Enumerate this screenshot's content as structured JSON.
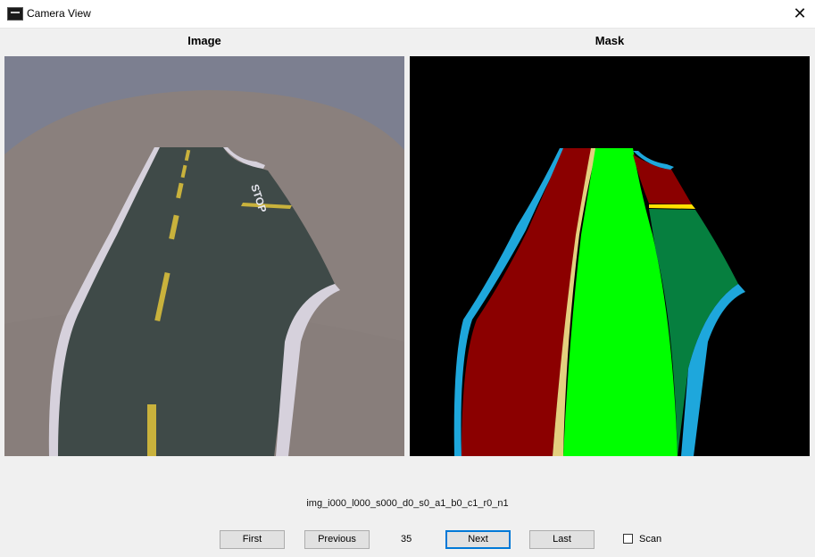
{
  "window": {
    "title": "Camera View",
    "app_icon": "camera-window-icon",
    "close_icon": "close-icon",
    "close_glyph": "✕"
  },
  "panels": {
    "image_title": "Image",
    "mask_title": "Mask"
  },
  "image": {
    "road_marking_text": "STOP"
  },
  "mask": {
    "colors": {
      "background": "#000000",
      "curb": "#1ea7dc",
      "left_lane": "#8b0000",
      "center_line": "#e3d07f",
      "right_lane": "#00ff00",
      "turn_lane": "#067f3f",
      "stop_line": "#ffe000"
    }
  },
  "status": {
    "filename": "img_i000_l000_s000_d0_s0_a1_b0_c1_r0_n1",
    "index": "35"
  },
  "controls": {
    "first_label": "First",
    "previous_label": "Previous",
    "next_label": "Next",
    "last_label": "Last",
    "scan_label": "Scan",
    "scan_checked": false
  }
}
